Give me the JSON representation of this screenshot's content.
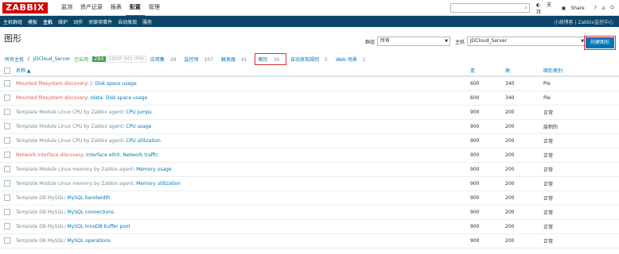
{
  "topbar": {
    "logo": "ZABBIX",
    "menu": [
      "监测",
      "资产记录",
      "报表",
      "配置",
      "管理"
    ],
    "active_menu": "配置",
    "support": "支持",
    "share": "Share",
    "help": "?"
  },
  "subnav": {
    "items": [
      "主机群组",
      "模板",
      "主机",
      "维护",
      "动作",
      "关联项事件",
      "自动发现",
      "服务"
    ],
    "active": "主机",
    "right_text": "小胡博客 | Zabbix监控中心"
  },
  "page": {
    "title": "图形",
    "group_label": "群组",
    "group_value": "所有",
    "host_label": "主机",
    "host_value": "JDCloud_Server",
    "create_button": "创建图形"
  },
  "tabs": {
    "all_hosts": "所有主机",
    "host": "JDCloud_Server",
    "enabled": "已启用",
    "zbx": "ZBX",
    "other_agents": "SNMP JMX IPMI",
    "apps": "应用集",
    "apps_count": "29",
    "items": "监控项",
    "items_count": "167",
    "triggers": "触发器",
    "triggers_count": "41",
    "graphs": "图形",
    "graphs_count": "36",
    "discovery": "自动发现规则",
    "discovery_count": "5",
    "web": "Web 场景",
    "web_count": "1"
  },
  "table": {
    "headers": {
      "name": "名称 ▲",
      "width": "宽",
      "height": "高",
      "type": "图形类别"
    },
    "rows": [
      {
        "prefix": "Mounted filesystem discovery",
        "prefix_style": "red",
        "name": "/: Disk space usage",
        "width": "600",
        "height": "340",
        "type": "Pie"
      },
      {
        "prefix": "Mounted filesystem discovery",
        "prefix_style": "red",
        "name": "/data: Disk space usage",
        "width": "600",
        "height": "340",
        "type": "Pie"
      },
      {
        "prefix": "Template Module Linux CPU by Zabbix agent",
        "prefix_style": "gray",
        "name": "CPU jumps",
        "width": "900",
        "height": "200",
        "type": "正常"
      },
      {
        "prefix": "Template Module Linux CPU by Zabbix agent",
        "prefix_style": "gray",
        "name": "CPU usage",
        "width": "900",
        "height": "200",
        "type": "层积的"
      },
      {
        "prefix": "Template Module Linux CPU by Zabbix agent",
        "prefix_style": "gray",
        "name": "CPU utilization",
        "width": "900",
        "height": "200",
        "type": "正常"
      },
      {
        "prefix": "Network interface discovery",
        "prefix_style": "red",
        "name": "Interface eth0: Network traffic",
        "width": "900",
        "height": "200",
        "type": "正常"
      },
      {
        "prefix": "Template Module Linux memory by Zabbix agent",
        "prefix_style": "gray",
        "name": "Memory usage",
        "width": "900",
        "height": "200",
        "type": "正常"
      },
      {
        "prefix": "Template Module Linux memory by Zabbix agent",
        "prefix_style": "gray",
        "name": "Memory utilization",
        "width": "900",
        "height": "200",
        "type": "正常"
      },
      {
        "prefix": "Template DB MySQL",
        "prefix_style": "gray",
        "name": "MySQL bandwidth",
        "width": "900",
        "height": "200",
        "type": "正常"
      },
      {
        "prefix": "Template DB MySQL",
        "prefix_style": "gray",
        "name": "MySQL connections",
        "width": "900",
        "height": "200",
        "type": "正常"
      },
      {
        "prefix": "Template DB MySQL",
        "prefix_style": "gray",
        "name": "MySQL InnoDB buffer pool",
        "width": "900",
        "height": "200",
        "type": "正常"
      },
      {
        "prefix": "Template DB MySQL",
        "prefix_style": "gray",
        "name": "MySQL operations",
        "width": "900",
        "height": "200",
        "type": "正常"
      }
    ]
  }
}
